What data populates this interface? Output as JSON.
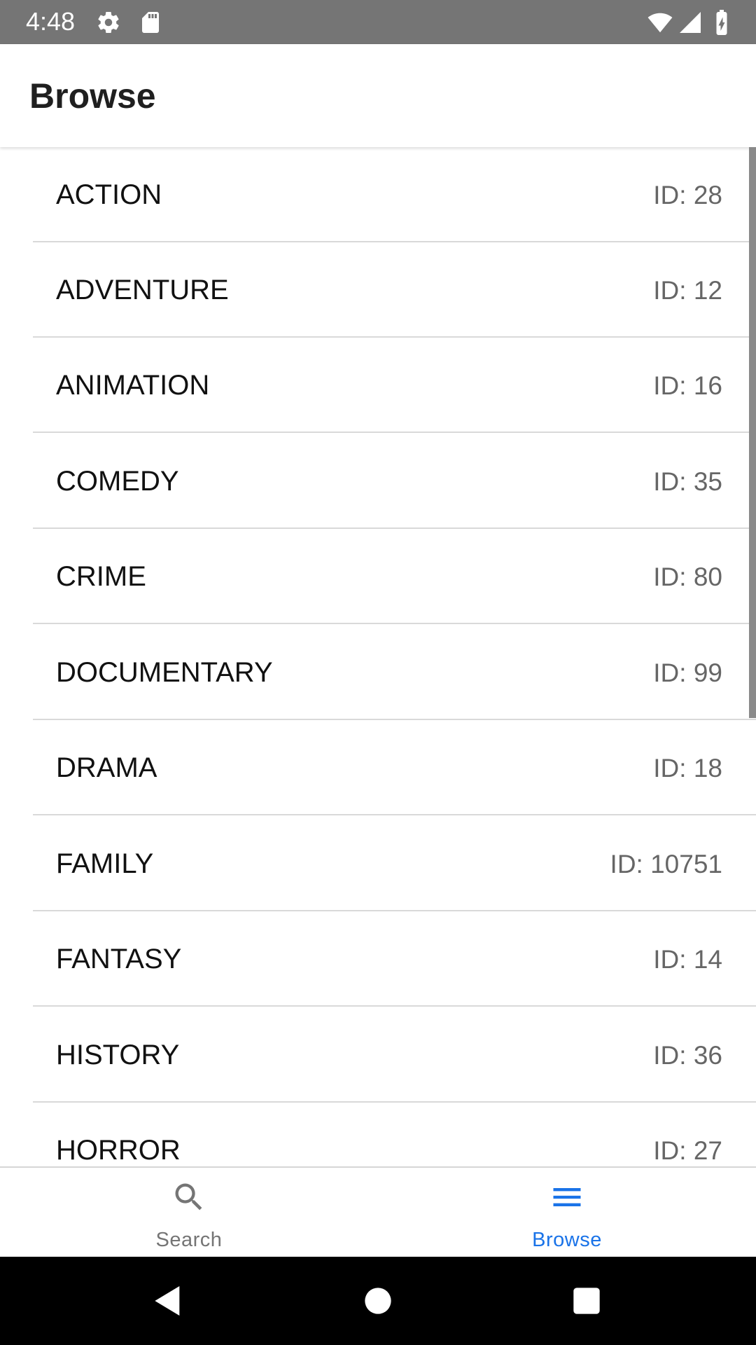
{
  "status_bar": {
    "time": "4:48",
    "icons": [
      "gear-icon",
      "sd-card-icon",
      "wifi-icon",
      "cellular-signal-icon",
      "battery-charging-icon"
    ]
  },
  "header": {
    "title": "Browse"
  },
  "genres": [
    {
      "name": "ACTION",
      "id": "ID: 28"
    },
    {
      "name": "ADVENTURE",
      "id": "ID: 12"
    },
    {
      "name": "ANIMATION",
      "id": "ID: 16"
    },
    {
      "name": "COMEDY",
      "id": "ID: 35"
    },
    {
      "name": "CRIME",
      "id": "ID: 80"
    },
    {
      "name": "DOCUMENTARY",
      "id": "ID: 99"
    },
    {
      "name": "DRAMA",
      "id": "ID: 18"
    },
    {
      "name": "FAMILY",
      "id": "ID: 10751"
    },
    {
      "name": "FANTASY",
      "id": "ID: 14"
    },
    {
      "name": "HISTORY",
      "id": "ID: 36"
    },
    {
      "name": "HORROR",
      "id": "ID: 27"
    }
  ],
  "tabs": [
    {
      "label": "Search",
      "icon": "search-icon",
      "active": false
    },
    {
      "label": "Browse",
      "icon": "menu-icon",
      "active": true
    }
  ],
  "colors": {
    "active_tab": "#1a73e8",
    "inactive_tab": "#757575",
    "status_bar": "#757575"
  },
  "nav_bar": {
    "buttons": [
      "back-icon",
      "home-icon",
      "recents-icon"
    ]
  }
}
